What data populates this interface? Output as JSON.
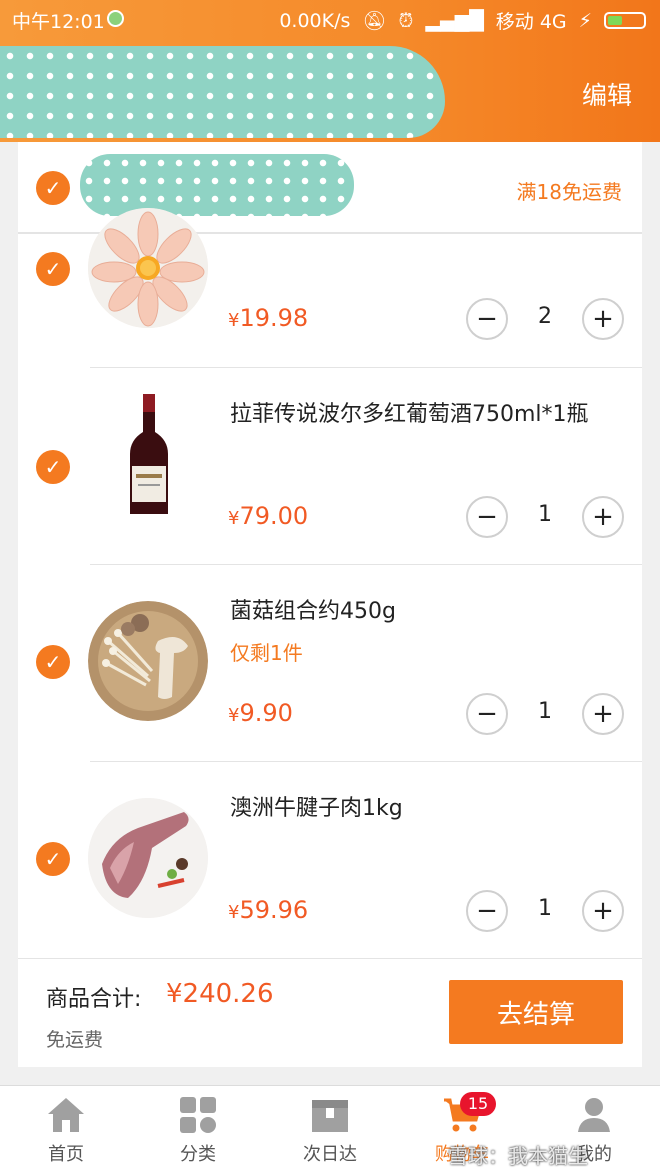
{
  "status_bar": {
    "time": "中午12:01",
    "network_speed": "0.00K/s",
    "carrier": "移动 4G"
  },
  "header": {
    "edit_label": "编辑"
  },
  "store": {
    "free_shipping_note": "满18免运费"
  },
  "items": [
    {
      "name": "",
      "price": "19.98",
      "quantity": "2",
      "stock_note": "",
      "image": "chicken-wings"
    },
    {
      "name": "拉菲传说波尔多红葡萄酒750ml*1瓶",
      "price": "79.00",
      "quantity": "1",
      "stock_note": "",
      "image": "wine-bottle"
    },
    {
      "name": "菌菇组合约450g",
      "price": "9.90",
      "quantity": "1",
      "stock_note": "仅剩1件",
      "image": "mushrooms"
    },
    {
      "name": "澳洲牛腱子肉1kg",
      "price": "59.96",
      "quantity": "1",
      "stock_note": "",
      "image": "beef-shank"
    }
  ],
  "currency_symbol": "¥",
  "stepper": {
    "minus": "−",
    "plus": "+"
  },
  "summary": {
    "total_label": "商品合计:",
    "total_value": "¥240.26",
    "shipping": "免运费",
    "checkout_label": "去结算"
  },
  "tabbar": {
    "tabs": [
      {
        "label": "首页",
        "icon": "home-icon"
      },
      {
        "label": "分类",
        "icon": "grid-icon"
      },
      {
        "label": "次日达",
        "icon": "box-icon"
      },
      {
        "label": "购物车",
        "icon": "cart-icon"
      },
      {
        "label": "我的",
        "icon": "user-icon"
      }
    ],
    "cart_badge": "15"
  },
  "watermark": "雪球：我本猫生",
  "colors": {
    "accent": "#f47a20",
    "price": "#f15a24",
    "header": "#f58a2a"
  }
}
